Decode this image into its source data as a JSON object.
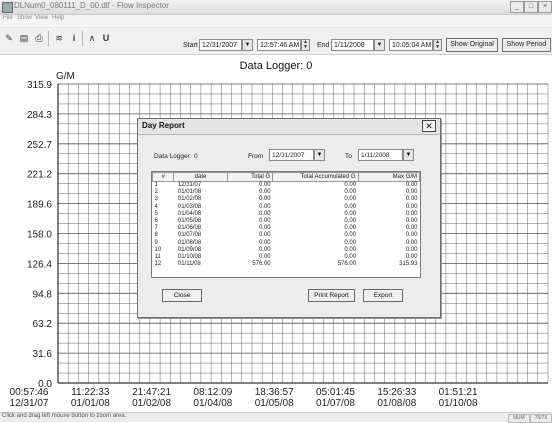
{
  "window": {
    "title": "DLNum0_080111_D_00.dlf - Flow Inspector",
    "controls": [
      "_",
      "□",
      "×"
    ]
  },
  "menu": [
    "File",
    "Show",
    "View",
    "Help"
  ],
  "toolbar": {
    "icons": [
      "pen-icon",
      "open-icon",
      "print-icon",
      "flow-icon",
      "info-icon",
      "a-icon",
      "u-icon"
    ],
    "icon_glyphs": [
      "✎",
      "▤",
      "⎙",
      "≋",
      "i",
      "∧",
      "U"
    ],
    "start_label": "Start",
    "start_date": "12/31/2007",
    "start_time": "12:57:46 AM",
    "end_label": "End",
    "end_date": "1/11/2008",
    "end_time": "10:05:04 AM",
    "show_original": "Show Original",
    "show_period": "Show Period"
  },
  "chart": {
    "title": "Data Logger: 0",
    "unit": "G/M"
  },
  "chart_data": {
    "type": "line",
    "title": "Data Logger: 0",
    "ylabel": "G/M",
    "ylim": [
      0.0,
      315.9
    ],
    "y_ticks": [
      "315.9",
      "284.3",
      "252.7",
      "221.2",
      "189.6",
      "158.0",
      "126.4",
      "94.8",
      "63.2",
      "31.6",
      "0.0"
    ],
    "x_ticks": [
      {
        "time": "00:57:46",
        "date": "12/31/07"
      },
      {
        "time": "11:22:33",
        "date": "01/01/08"
      },
      {
        "time": "21:47:21",
        "date": "01/02/08"
      },
      {
        "time": "08:12:09",
        "date": "01/04/08"
      },
      {
        "time": "18:36:57",
        "date": "01/05/08"
      },
      {
        "time": "05:01:45",
        "date": "01/07/08"
      },
      {
        "time": "15:26:33",
        "date": "01/08/08"
      },
      {
        "time": "01:51:21",
        "date": "01/10/08"
      }
    ],
    "grid": true,
    "series": []
  },
  "dialog": {
    "title": "Day Report",
    "close_glyph": "✕",
    "logger_label": "Data Logger:",
    "logger_value": "0",
    "from_label": "From",
    "from_value": "12/31/2007",
    "to_label": "To",
    "to_value": "1/11/2008",
    "columns": [
      "#",
      "date",
      "Total G",
      "Total Accumulated G",
      "Max G/M"
    ],
    "rows": [
      [
        "1",
        "12/31/07",
        "0.00",
        "0.00",
        "0.00"
      ],
      [
        "2",
        "01/01/08",
        "0.00",
        "0.00",
        "0.00"
      ],
      [
        "3",
        "01/02/08",
        "0.00",
        "0.00",
        "0.00"
      ],
      [
        "4",
        "01/03/08",
        "0.00",
        "0.00",
        "0.00"
      ],
      [
        "5",
        "01/04/08",
        "0.00",
        "0.00",
        "0.00"
      ],
      [
        "6",
        "01/05/08",
        "0.00",
        "0.00",
        "0.00"
      ],
      [
        "7",
        "01/06/08",
        "0.00",
        "0.00",
        "0.00"
      ],
      [
        "8",
        "01/07/08",
        "0.00",
        "0.00",
        "0.00"
      ],
      [
        "9",
        "01/08/08",
        "0.00",
        "0.00",
        "0.00"
      ],
      [
        "10",
        "01/09/08",
        "0.00",
        "0.00",
        "0.00"
      ],
      [
        "11",
        "01/10/08",
        "0.00",
        "0.00",
        "0.00"
      ],
      [
        "12",
        "01/11/08",
        "576.00",
        "576.00",
        "315.93"
      ]
    ],
    "close_button": "Close",
    "print_button": "Print Report",
    "export_button": "Export"
  },
  "status": {
    "text": "Click and drag left mouse button to zoom area.",
    "num": "NUM",
    "page": "75/75"
  }
}
